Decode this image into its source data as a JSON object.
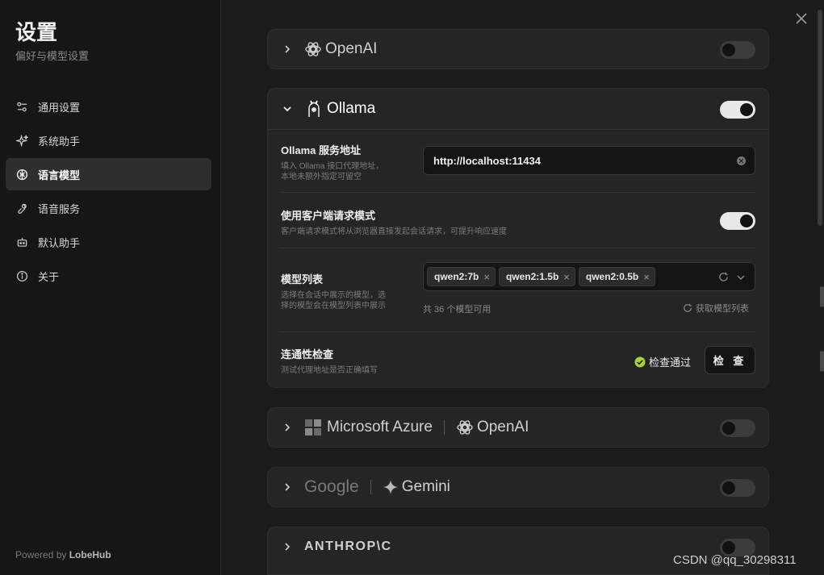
{
  "sidebar": {
    "title": "设置",
    "subtitle": "偏好与模型设置",
    "items": [
      {
        "label": "通用设置",
        "icon": "sliders-icon",
        "active": false
      },
      {
        "label": "系统助手",
        "icon": "sparkles-icon",
        "active": false
      },
      {
        "label": "语言模型",
        "icon": "brain-icon",
        "active": true
      },
      {
        "label": "语音服务",
        "icon": "voice-icon",
        "active": false
      },
      {
        "label": "默认助手",
        "icon": "bot-icon",
        "active": false
      },
      {
        "label": "关于",
        "icon": "info-icon",
        "active": false
      }
    ],
    "powered_prefix": "Powered by",
    "powered_brand": "LobeHub"
  },
  "providers": {
    "openai": {
      "name": "OpenAI",
      "enabled": false
    },
    "ollama": {
      "name": "Ollama",
      "enabled": true,
      "endpoint": {
        "title": "Ollama 服务地址",
        "desc_line1": "填入 Ollama 接口代理地址，",
        "desc_line2": "本地未额外指定可留空",
        "value": "http://localhost:11434"
      },
      "client_mode": {
        "title": "使用客户端请求模式",
        "desc": "客户端请求模式将从浏览器直接发起会话请求，可提升响应速度",
        "enabled": true
      },
      "model_list": {
        "title": "模型列表",
        "desc_line1": "选择在会话中展示的模型，选",
        "desc_line2": "择的模型会在模型列表中展示",
        "tags": [
          "qwen2:7b",
          "qwen2:1.5b",
          "qwen2:0.5b"
        ],
        "count_text": "共 36 个模型可用",
        "fetch_label": "获取模型列表"
      },
      "connectivity": {
        "title": "连通性检查",
        "desc": "测试代理地址是否正确填写",
        "status": "检查通过",
        "button": "检 查"
      }
    },
    "azure": {
      "name": "Microsoft Azure",
      "name2": "OpenAI",
      "enabled": false
    },
    "google": {
      "name": "Google",
      "name2": "Gemini",
      "enabled": false
    },
    "anthropic": {
      "name": "ANTHROP\\C",
      "enabled": false
    }
  },
  "watermark": "CSDN @qq_30298311",
  "colors": {
    "success": "#a6d43a",
    "toggle_on": "#e8e8e8",
    "toggle_off": "#3c3c3c"
  }
}
